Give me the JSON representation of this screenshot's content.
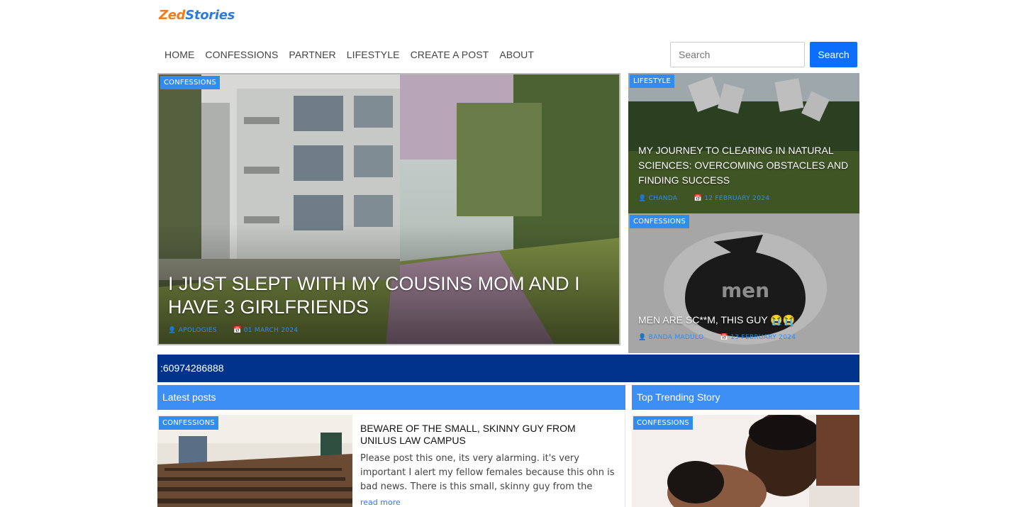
{
  "brand": {
    "part1": "Zed",
    "part2": "Stories"
  },
  "nav": [
    "HOME",
    "CONFESSIONS",
    "PARTNER",
    "LIFESTYLE",
    "CREATE A POST",
    "ABOUT"
  ],
  "search": {
    "placeholder": "Search",
    "button": "Search"
  },
  "hero": {
    "tag": "CONFESSIONS",
    "title": "I JUST SLEPT WITH MY COUSINS MOM AND I HAVE 3 GIRLFRIENDS",
    "author": "APOLOGIES",
    "date": "01 MARCH 2024"
  },
  "side_posts": [
    {
      "tag": "LIFESTYLE",
      "title": "MY JOURNEY TO CLEARING IN NATURAL SCIENCES: OVERCOMING OBSTACLES AND FINDING SUCCESS",
      "author": "CHANDA",
      "date": "12 FEBRUARY 2024"
    },
    {
      "tag": "CONFESSIONS",
      "title": "MEN ARE SC**M, THIS GUY 😭😭",
      "author": "BANDA MADULO",
      "date": "13 FEBRUARY 2024",
      "image_text": "men"
    }
  ],
  "ticker": ":60974286888",
  "latest": {
    "heading": "Latest posts",
    "post": {
      "tag": "CONFESSIONS",
      "title": "BEWARE OF THE SMALL, SKINNY GUY FROM UNILUS LAW CAMPUS",
      "excerpt": "Please post this one, its very alarming. it's very important I alert my fellow females because this ohn is bad news. There is this small, skinny guy from the",
      "read_more": "read more"
    }
  },
  "trending": {
    "heading": "Top Trending Story",
    "tag": "CONFESSIONS"
  },
  "colors": {
    "accent": "#2f8cf0",
    "ticker": "#00348c",
    "button": "#0d6efd",
    "logo_orange": "#f07c1a"
  }
}
